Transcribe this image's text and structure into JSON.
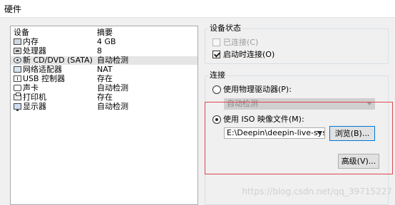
{
  "window": {
    "title": "硬件"
  },
  "device_list": {
    "headers": {
      "device": "设备",
      "summary": "摘要"
    },
    "rows": [
      {
        "name": "内存",
        "summary": "4 GB",
        "icon": "memory-icon"
      },
      {
        "name": "处理器",
        "summary": "8",
        "icon": "processor-icon"
      },
      {
        "name": "新 CD/DVD (SATA)",
        "summary": "自动检测",
        "icon": "cd-dvd-icon"
      },
      {
        "name": "网络适配器",
        "summary": "NAT",
        "icon": "network-adapter-icon"
      },
      {
        "name": "USB 控制器",
        "summary": "存在",
        "icon": "usb-icon"
      },
      {
        "name": "声卡",
        "summary": "自动检测",
        "icon": "sound-card-icon"
      },
      {
        "name": "打印机",
        "summary": "存在",
        "icon": "printer-icon"
      },
      {
        "name": "显示器",
        "summary": "自动检测",
        "icon": "monitor-icon"
      }
    ],
    "selected_index": 2
  },
  "device_status": {
    "label": "设备状态",
    "connected": {
      "label": "已连接(C)",
      "checked": false,
      "enabled": false
    },
    "connect_at_power_on": {
      "label": "启动时连接(O)",
      "checked": true
    }
  },
  "connection": {
    "label": "连接",
    "physical_drive": {
      "label": "使用物理驱动器(P):",
      "selected": false
    },
    "physical_drive_select": {
      "value": "自动检测",
      "enabled": false
    },
    "iso_image": {
      "label": "使用 ISO 映像文件(M):",
      "selected": true
    },
    "iso_path": {
      "value": "E:\\Deepin\\deepin-live-system-"
    },
    "browse_button": "浏览(B)...",
    "advanced_button": "高级(V)..."
  },
  "watermark": "https://blog.csdn.net/qq_39715227",
  "colors": {
    "highlight_border": "#e0474c",
    "selected_row": "#e5e5e5",
    "focus_border": "#0078d7"
  }
}
